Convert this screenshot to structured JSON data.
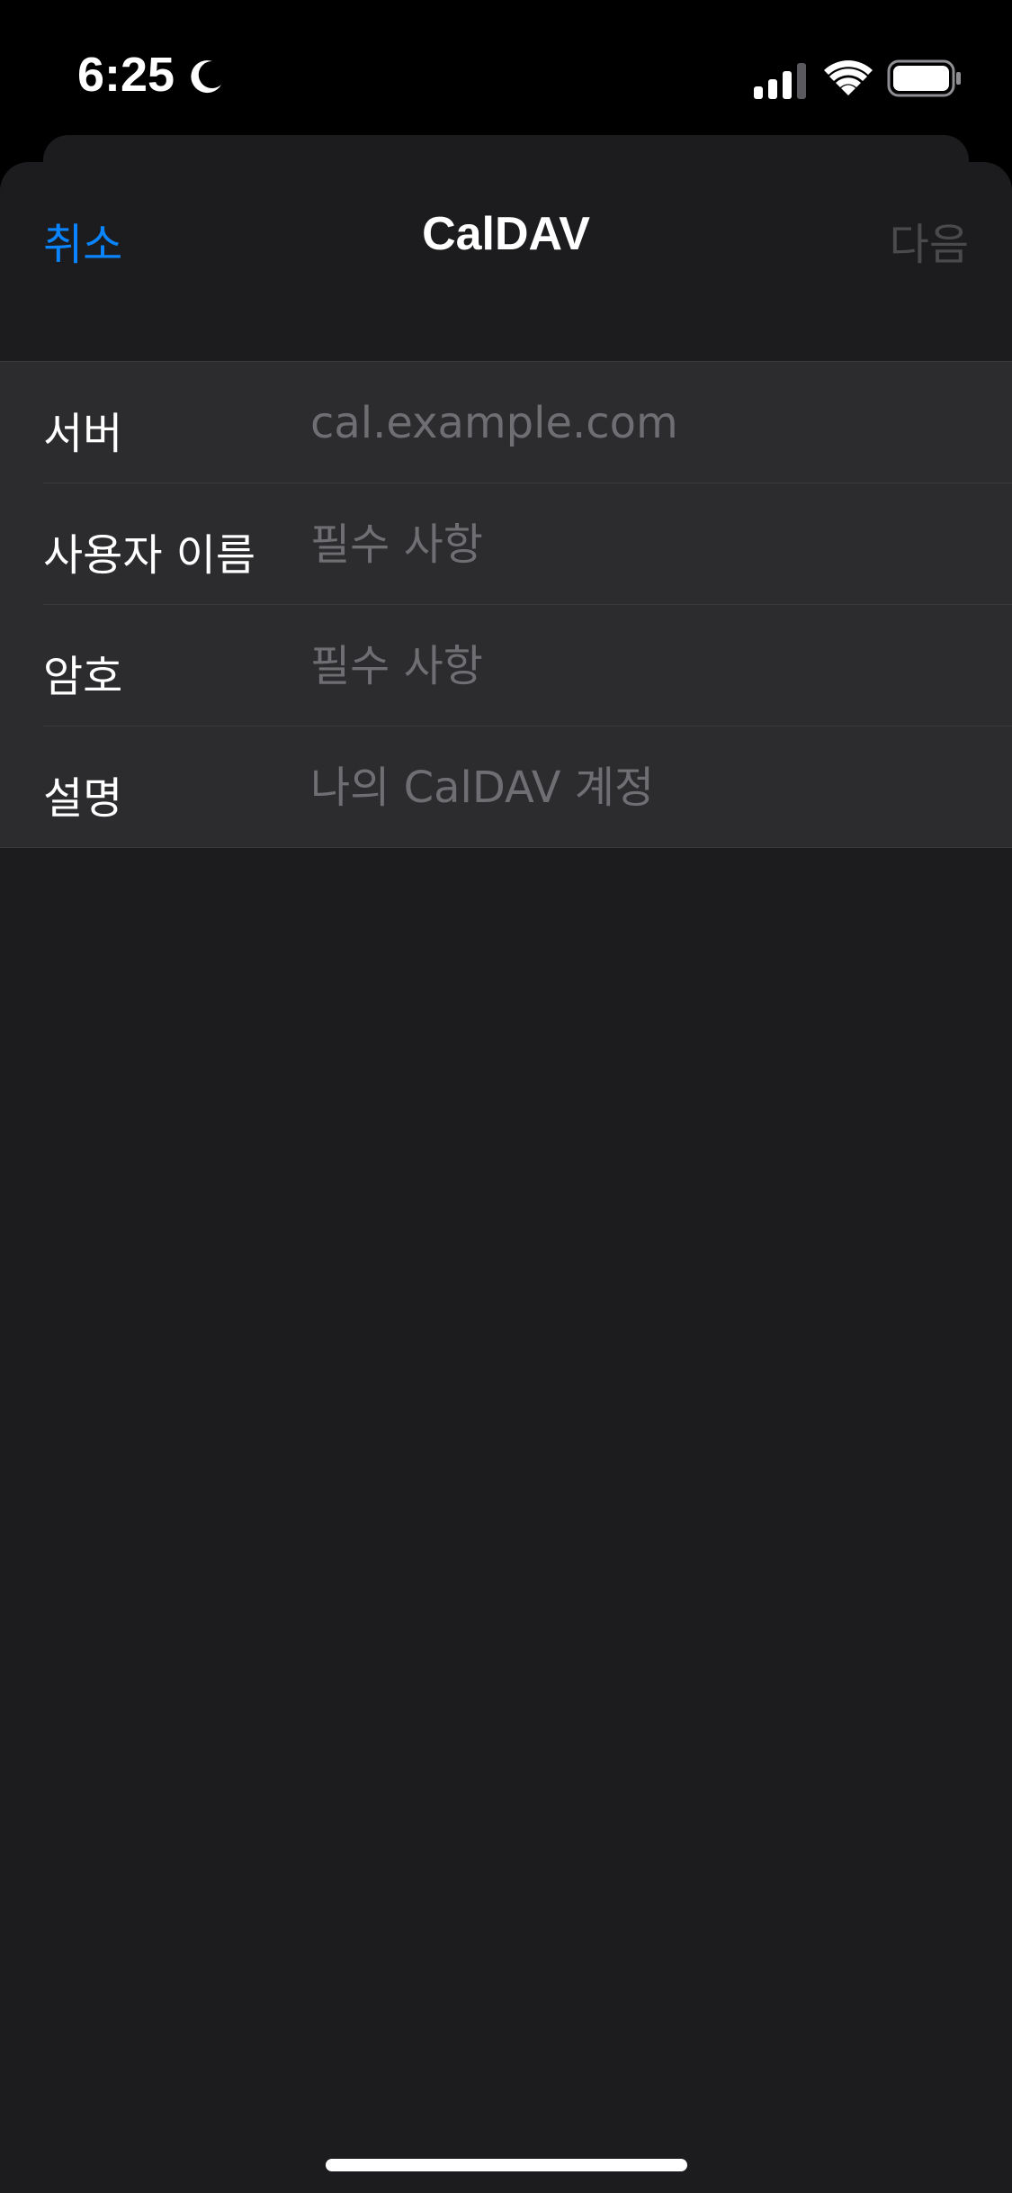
{
  "status_bar": {
    "time": "6:25",
    "focus_icon": "moon-icon",
    "signal_icon": "cellular-signal-icon",
    "wifi_icon": "wifi-icon",
    "battery_icon": "battery-icon"
  },
  "nav": {
    "cancel_label": "취소",
    "title": "CalDAV",
    "next_label": "다음"
  },
  "form": {
    "rows": [
      {
        "label": "서버",
        "placeholder": "cal.example.com",
        "value": ""
      },
      {
        "label": "사용자 이름",
        "placeholder": "필수 사항",
        "value": ""
      },
      {
        "label": "암호",
        "placeholder": "필수 사항",
        "value": ""
      },
      {
        "label": "설명",
        "placeholder": "나의 CalDAV 계정",
        "value": ""
      }
    ]
  },
  "colors": {
    "accent": "#0a84ff",
    "disabled": "#4a4a4c",
    "background": "#1c1c1e",
    "cell": "#2c2c2e"
  }
}
